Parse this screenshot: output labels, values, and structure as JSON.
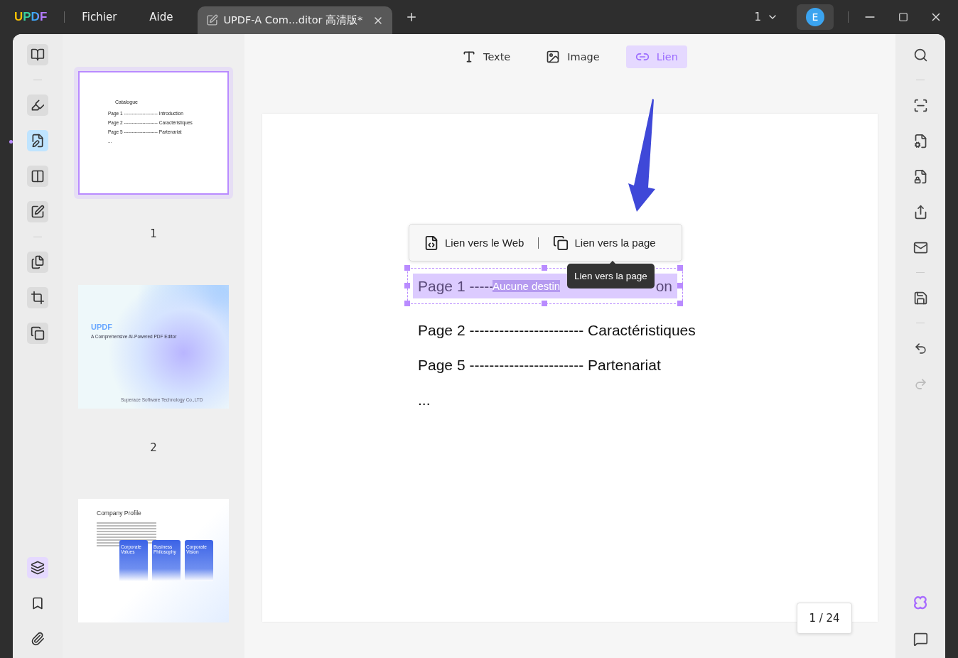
{
  "title_bar": {
    "logo": "UPDF",
    "menus": [
      "Fichier",
      "Aide"
    ],
    "tab": {
      "title": "UPDF-A Com...ditor 高清版*"
    },
    "page_selector": "1",
    "avatar": "E"
  },
  "left_tools": [
    [
      {
        "selected": false
      }
    ],
    [
      {
        "selected": false
      },
      {
        "selected": true
      },
      {
        "selected": false
      },
      {
        "selected": false
      }
    ],
    [
      {
        "selected": false
      },
      {
        "selected": false
      },
      {
        "selected": false
      }
    ]
  ],
  "left_bottom": [
    {
      "selected": true
    },
    {
      "selected": false
    },
    {
      "selected": false
    }
  ],
  "thumbnails": [
    {
      "kind": "catalogue",
      "number": "1",
      "selected": true,
      "heading": "Catalogue",
      "lines": [
        "Page 1 ---------------------- Introduction",
        "Page 2 ---------------------- Caractéristiques",
        "Page 5 ---------------------- Partenariat",
        "..."
      ]
    },
    {
      "kind": "cover",
      "number": "2",
      "selected": false,
      "logo": "UPDF",
      "subtitle": "A Comprehensive AI-Powered PDF Editor",
      "footer": "Superace Software Technology Co.,LTD"
    },
    {
      "kind": "profile",
      "selected": false,
      "heading": "Company Profile",
      "cards": [
        "Corporate Values",
        "Business Philosophy",
        "Corporate Vision"
      ]
    }
  ],
  "toolbar": [
    {
      "label": "Texte",
      "selected": false
    },
    {
      "label": "Image",
      "selected": false
    },
    {
      "label": "Lien",
      "selected": true
    }
  ],
  "link_menu": {
    "items": [
      "Lien vers le Web",
      "Lien vers la page"
    ],
    "tooltip": "Lien vers la page"
  },
  "page": {
    "link_line": {
      "start": "Page 1 -----",
      "placeholder": "Aucune destin",
      "end": "on"
    },
    "lines": [
      "Page 2 ----------------------- Caractéristiques",
      "Page 5 ----------------------- Partenariat",
      "..."
    ]
  },
  "page_counter": "1 / 24"
}
